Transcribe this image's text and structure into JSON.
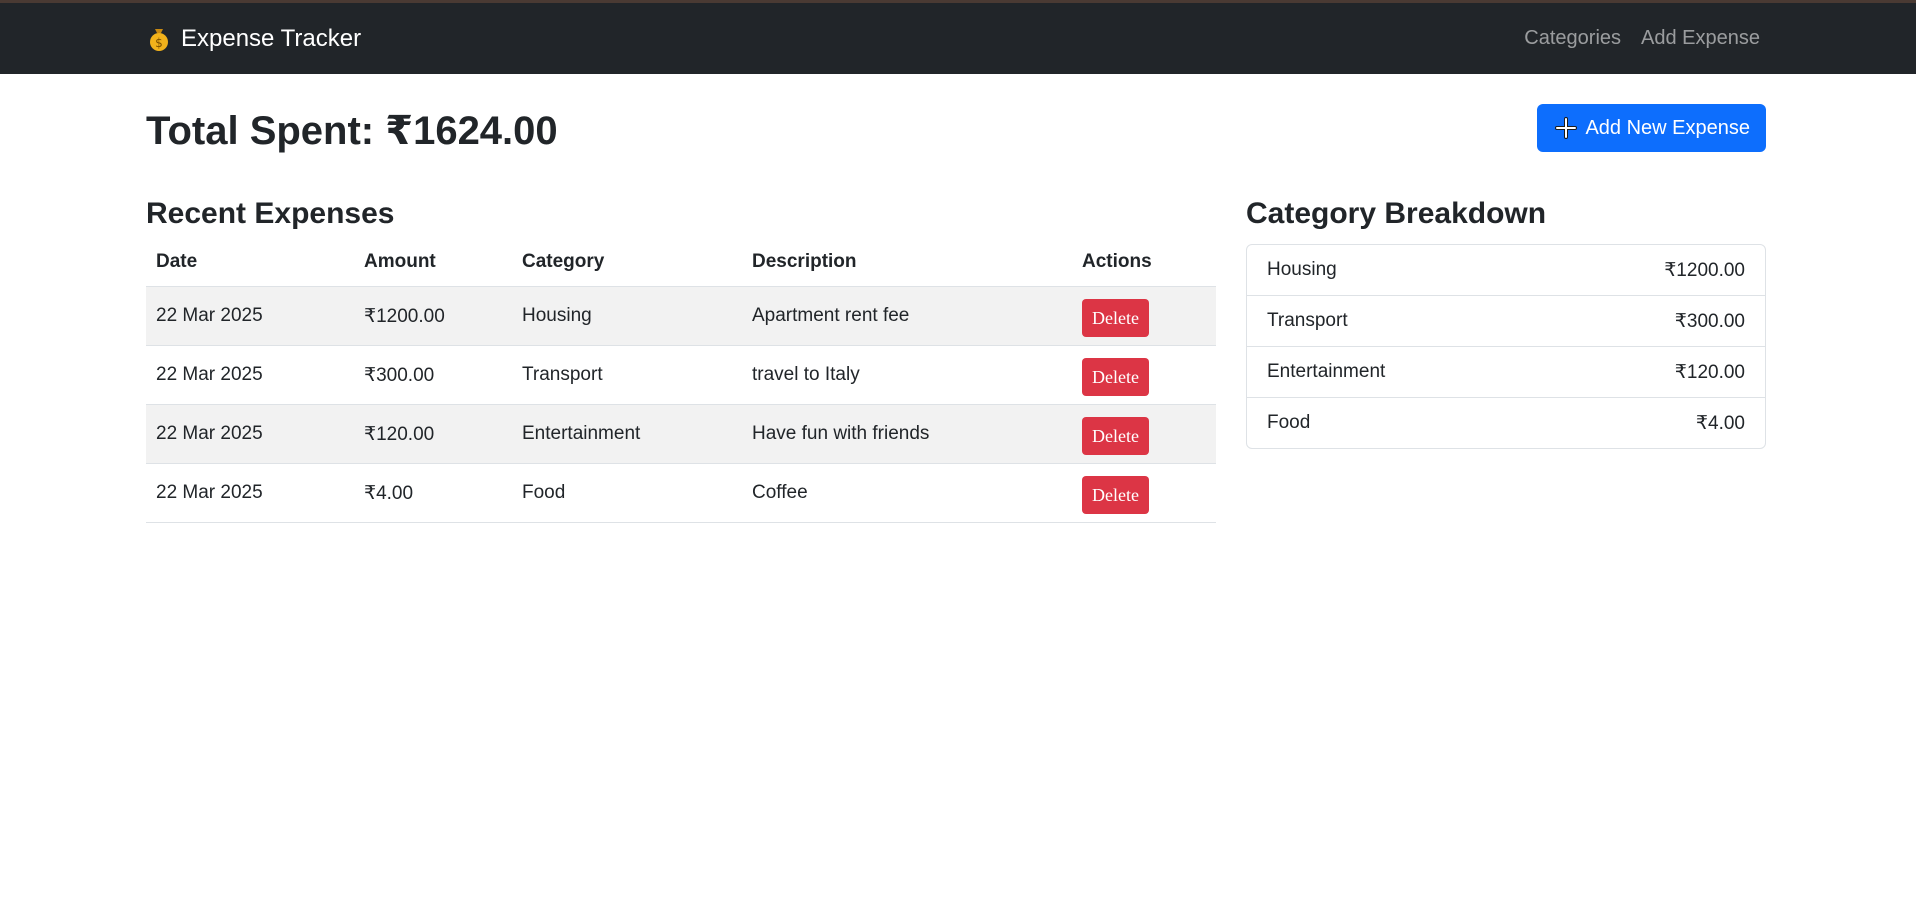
{
  "navbar": {
    "brand_icon": "money-bag-icon",
    "brand": "Expense Tracker",
    "links": [
      "Categories",
      "Add Expense"
    ]
  },
  "header": {
    "total": "Total Spent: ₹1624.00",
    "add_button": "Add New Expense",
    "add_icon": "plus-icon"
  },
  "expenses": {
    "title": "Recent Expenses",
    "columns": [
      "Date",
      "Amount",
      "Category",
      "Description",
      "Actions"
    ],
    "rows": [
      {
        "date": "22 Mar 2025",
        "amount": "₹1200.00",
        "category": "Housing",
        "description": "Apartment rent fee",
        "action": "Delete"
      },
      {
        "date": "22 Mar 2025",
        "amount": "₹300.00",
        "category": "Transport",
        "description": "travel to Italy",
        "action": "Delete"
      },
      {
        "date": "22 Mar 2025",
        "amount": "₹120.00",
        "category": "Entertainment",
        "description": "Have fun with friends",
        "action": "Delete"
      },
      {
        "date": "22 Mar 2025",
        "amount": "₹4.00",
        "category": "Food",
        "description": "Coffee",
        "action": "Delete"
      }
    ]
  },
  "breakdown": {
    "title": "Category Breakdown",
    "items": [
      {
        "name": "Housing",
        "amount": "₹1200.00"
      },
      {
        "name": "Transport",
        "amount": "₹300.00"
      },
      {
        "name": "Entertainment",
        "amount": "₹120.00"
      },
      {
        "name": "Food",
        "amount": "₹4.00"
      }
    ]
  },
  "colors": {
    "navbar_bg": "#212529",
    "primary": "#0d6efd",
    "danger": "#dc3545",
    "stripe": "#f2f2f2"
  }
}
